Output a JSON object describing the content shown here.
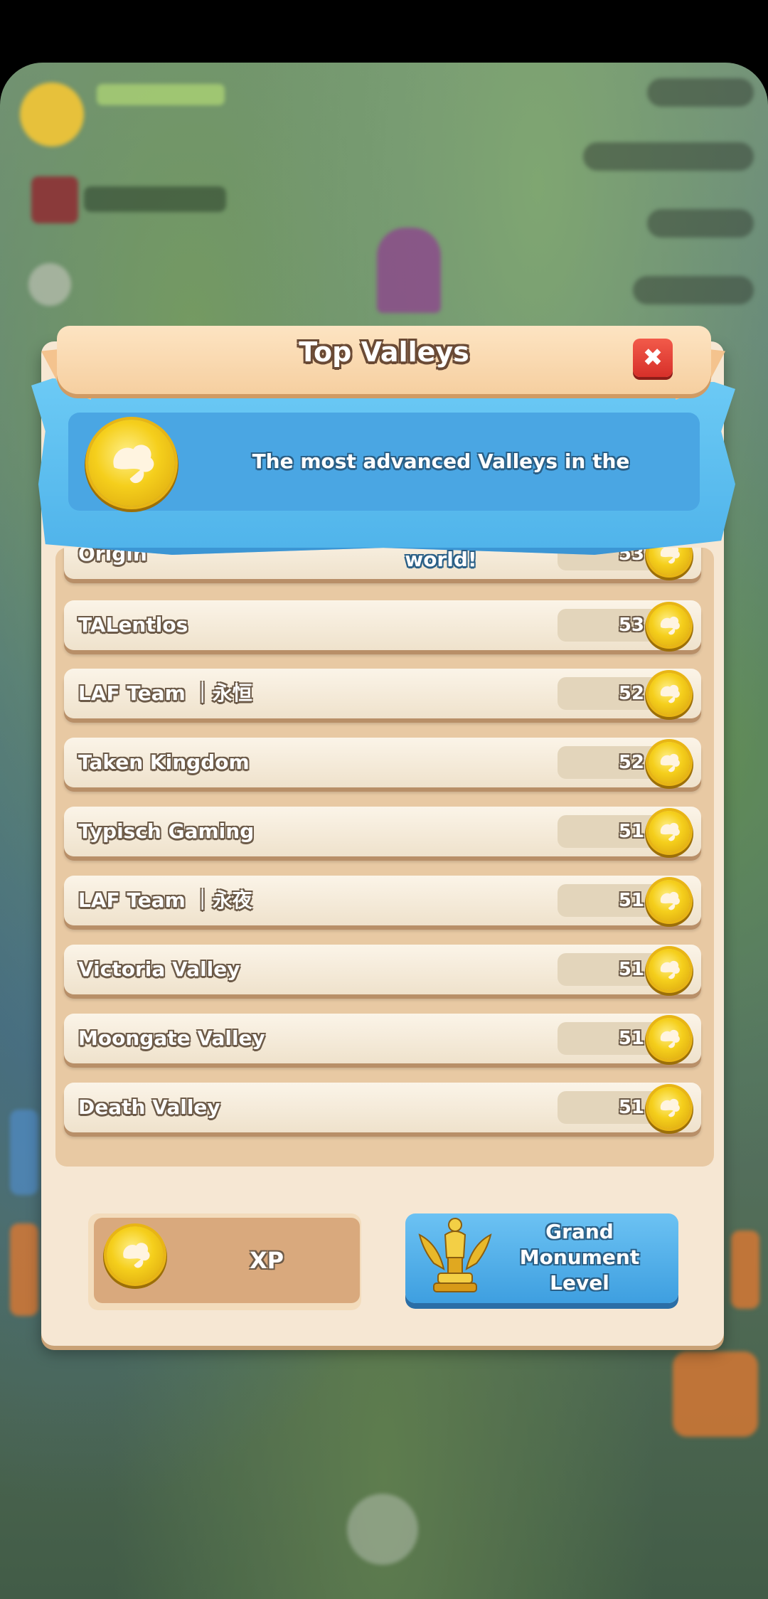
{
  "dialog": {
    "title": "Top Valleys",
    "close_label": "✖",
    "subtitle": "The most advanced Valleys in the world!"
  },
  "rows": [
    {
      "name": "Origin",
      "value": "53"
    },
    {
      "name": "TALentlos",
      "value": "53"
    },
    {
      "name": "LAF Team ｜永恒",
      "value": "52"
    },
    {
      "name": "Taken Kingdom",
      "value": "52"
    },
    {
      "name": "Typisch Gaming",
      "value": "51"
    },
    {
      "name": "LAF Team ｜永夜",
      "value": "51"
    },
    {
      "name": "Victoria Valley",
      "value": "51"
    },
    {
      "name": "Moongate Valley",
      "value": "51"
    },
    {
      "name": "Death Valley",
      "value": "51"
    }
  ],
  "footer": {
    "xp_label": "XP",
    "gml_label": "Grand Monument Level"
  },
  "colors": {
    "panel": "#f6e7d3",
    "blue": "#4fb3ea",
    "close": "#d7302a",
    "coin": "#f5cf1c"
  },
  "icons": {
    "coin": "xp-coin-icon",
    "trophy": "grand-monument-trophy-icon",
    "close": "close-icon"
  }
}
